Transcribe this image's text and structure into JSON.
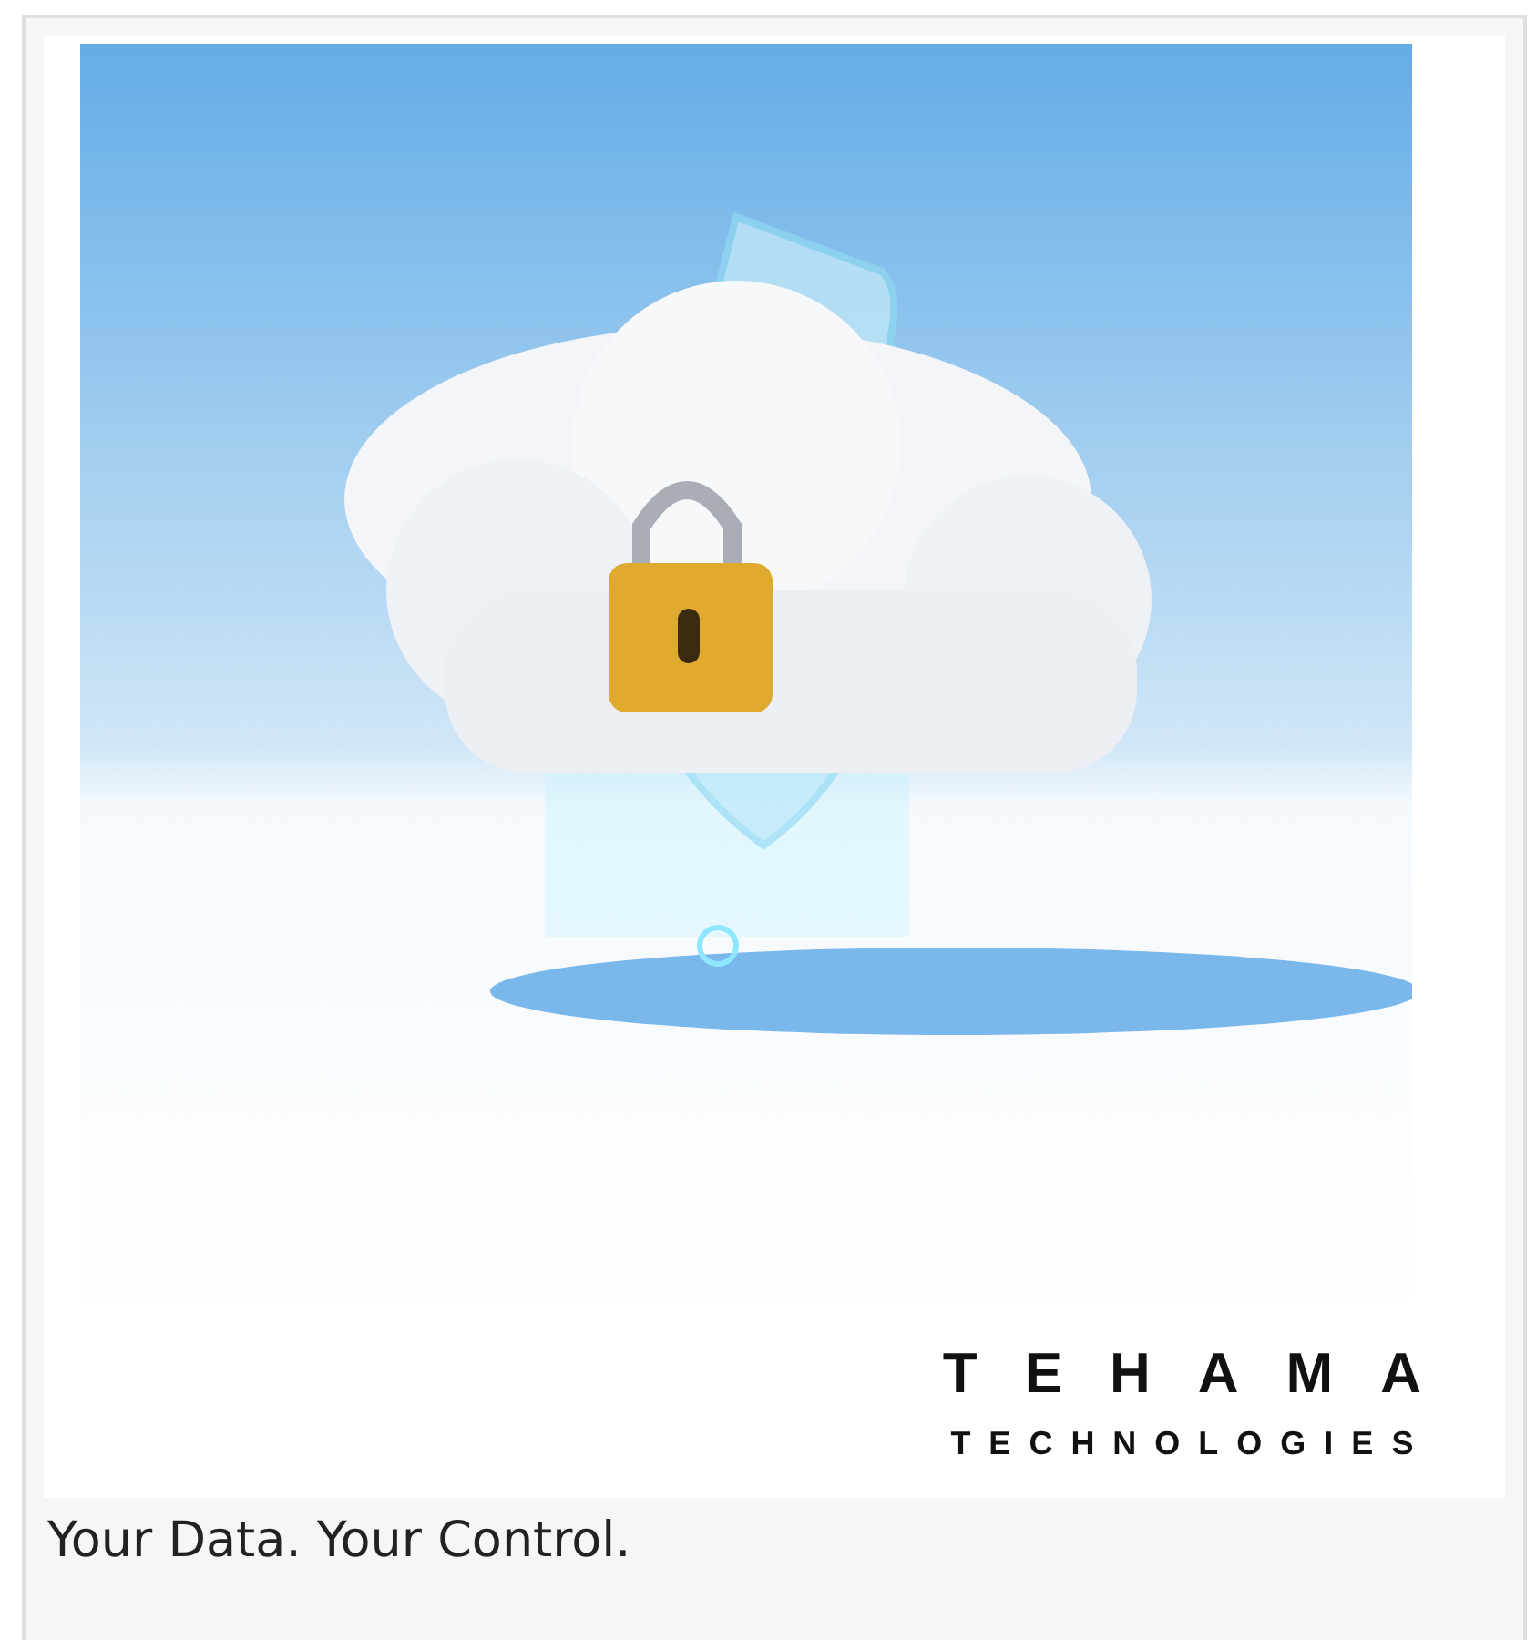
{
  "figure": {
    "logo": {
      "name": "TEHAMA",
      "tagline": "TECHNOLOGIES"
    },
    "caption": "Your Data. Your Control."
  }
}
